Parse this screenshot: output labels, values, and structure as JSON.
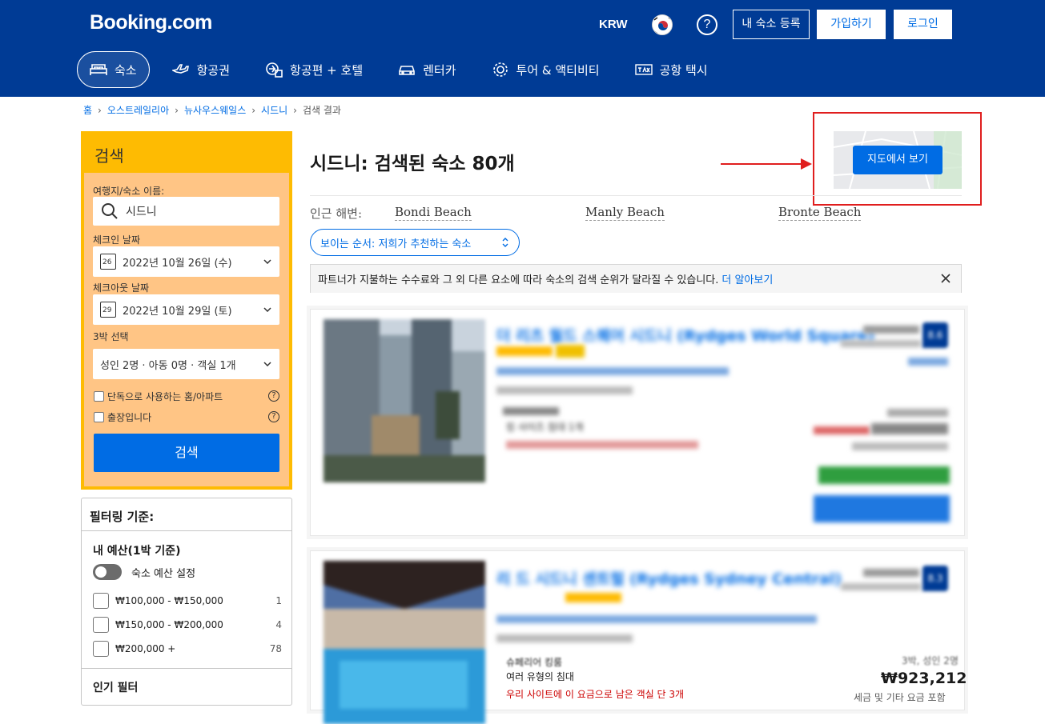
{
  "header": {
    "logo": "Booking.com",
    "currency": "KRW",
    "help_glyph": "?",
    "list_property": "내 숙소 등록",
    "signup": "가입하기",
    "login": "로그인",
    "nav": [
      {
        "label": "숙소",
        "icon": "bed-icon",
        "active": true
      },
      {
        "label": "항공권",
        "icon": "plane-icon"
      },
      {
        "label": "항공편 + 호텔",
        "icon": "plane-hotel-icon"
      },
      {
        "label": "렌터카",
        "icon": "car-icon"
      },
      {
        "label": "투어 & 액티비티",
        "icon": "attractions-icon"
      },
      {
        "label": "공항 택시",
        "icon": "taxi-icon"
      }
    ],
    "colors": {
      "brand": "#003b95",
      "accent": "#006ce4",
      "search_panel": "#febb02"
    }
  },
  "breadcrumb": [
    "홈",
    "오스트레일리아",
    "뉴사우스웨일스",
    "시드니",
    "검색 결과"
  ],
  "search": {
    "title": "검색",
    "destination_label": "여행지/숙소 이름:",
    "destination_value": "시드니",
    "checkin_label": "체크인 날짜",
    "checkin_day": "26",
    "checkin_value": "2022년 10월 26일 (수)",
    "checkout_label": "체크아웃 날짜",
    "checkout_day": "29",
    "checkout_value": "2022년 10월 29일 (토)",
    "nights_label": "3박 선택",
    "guests_value": "성인 2명 · 아동 0명 · 객실 1개",
    "check_apartment": "단독으로 사용하는 홈/아파트",
    "check_business": "출장입니다",
    "help_glyph": "?",
    "button": "검색"
  },
  "filters": {
    "title": "필터링 기준:",
    "budget_title": "내 예산(1박 기준)",
    "budget_toggle": "숙소 예산 설정",
    "budget_options": [
      {
        "label": "₩100,000 - ₩150,000",
        "count": "1"
      },
      {
        "label": "₩150,000 - ₩200,000",
        "count": "4"
      },
      {
        "label": "₩200,000 +",
        "count": "78"
      }
    ],
    "popular_title": "인기 필터"
  },
  "main": {
    "title": "시드니: 검색된 숙소 80개",
    "map_button": "지도에서 보기",
    "beaches_label": "인근 해변:",
    "beaches": [
      "Bondi Beach",
      "Manly Beach",
      "Bronte Beach"
    ],
    "sort_label": "보이는 순서: 저희가 추천하는 숙소",
    "notice_text": "파트너가 지불하는 수수료와 그 외 다른 요소에 따라 숙소의 검색 순위가 달라질 수 있습니다.",
    "notice_link": "더 알아보기"
  },
  "results": [
    {
      "name": "더 리츠 월드 스퀘어 시드니 (Rydges World Square)",
      "score": "8.6",
      "room_name": "디럭스 킹룸",
      "bed": "킹 사이즈 침대 1개",
      "cta": "객실 이용 가능 여부 확인"
    },
    {
      "name": "리 드 시드니 센트럴 (Rydges Sydney Central)",
      "score": "8.3",
      "room_name": "슈페리어 킹룸",
      "bed": "여러 유형의 침대",
      "scarcity": "우리 사이트에 이 요금으로 남은 객실 단 3개",
      "price_meta": "3박, 성인 2명",
      "price": "₩923,212",
      "tax_note": "세금 및 기타 요금 포함"
    }
  ]
}
